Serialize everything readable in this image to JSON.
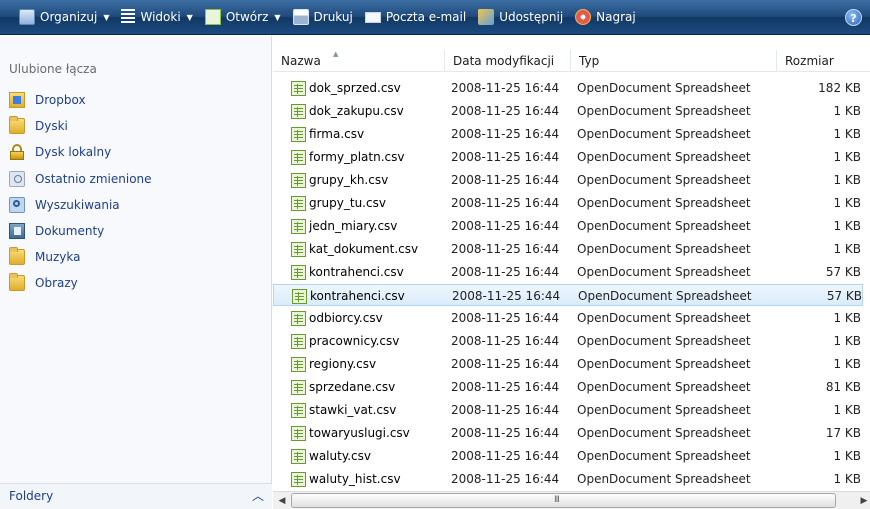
{
  "toolbar": {
    "organize": "Organizuj",
    "views": "Widoki",
    "open": "Otwórz",
    "print": "Drukuj",
    "email": "Poczta e-mail",
    "share": "Udostępnij",
    "burn": "Nagraj",
    "help": "?"
  },
  "sidebar": {
    "heading": "Ulubione łącza",
    "items": [
      {
        "label": "Dropbox",
        "icon": "dropbox-folder-icon"
      },
      {
        "label": "Dyski",
        "icon": "folder-icon"
      },
      {
        "label": "Dysk lokalny",
        "icon": "lock-icon"
      },
      {
        "label": "Ostatnio zmienione",
        "icon": "recent-icon"
      },
      {
        "label": "Wyszukiwania",
        "icon": "search-folder-icon"
      },
      {
        "label": "Dokumenty",
        "icon": "documents-icon"
      },
      {
        "label": "Muzyka",
        "icon": "folder-icon"
      },
      {
        "label": "Obrazy",
        "icon": "folder-icon"
      }
    ],
    "folders_label": "Foldery"
  },
  "columns": {
    "name": "Nazwa",
    "date": "Data modyfikacji",
    "type": "Typ",
    "size": "Rozmiar"
  },
  "files": [
    {
      "name": "dok_sprzed.csv",
      "date": "2008-11-25 16:44",
      "type": "OpenDocument Spreadsheet",
      "size": "182 KB"
    },
    {
      "name": "dok_zakupu.csv",
      "date": "2008-11-25 16:44",
      "type": "OpenDocument Spreadsheet",
      "size": "1 KB"
    },
    {
      "name": "firma.csv",
      "date": "2008-11-25 16:44",
      "type": "OpenDocument Spreadsheet",
      "size": "1 KB"
    },
    {
      "name": "formy_platn.csv",
      "date": "2008-11-25 16:44",
      "type": "OpenDocument Spreadsheet",
      "size": "1 KB"
    },
    {
      "name": "grupy_kh.csv",
      "date": "2008-11-25 16:44",
      "type": "OpenDocument Spreadsheet",
      "size": "1 KB"
    },
    {
      "name": "grupy_tu.csv",
      "date": "2008-11-25 16:44",
      "type": "OpenDocument Spreadsheet",
      "size": "1 KB"
    },
    {
      "name": "jedn_miary.csv",
      "date": "2008-11-25 16:44",
      "type": "OpenDocument Spreadsheet",
      "size": "1 KB"
    },
    {
      "name": "kat_dokument.csv",
      "date": "2008-11-25 16:44",
      "type": "OpenDocument Spreadsheet",
      "size": "1 KB"
    },
    {
      "name": "kontrahenci.csv",
      "date": "2008-11-25 16:44",
      "type": "OpenDocument Spreadsheet",
      "size": "57 KB"
    },
    {
      "name": "kontrahenci.csv",
      "date": "2008-11-25 16:44",
      "type": "OpenDocument Spreadsheet",
      "size": "57 KB",
      "selected": true
    },
    {
      "name": "odbiorcy.csv",
      "date": "2008-11-25 16:44",
      "type": "OpenDocument Spreadsheet",
      "size": "1 KB"
    },
    {
      "name": "pracownicy.csv",
      "date": "2008-11-25 16:44",
      "type": "OpenDocument Spreadsheet",
      "size": "1 KB"
    },
    {
      "name": "regiony.csv",
      "date": "2008-11-25 16:44",
      "type": "OpenDocument Spreadsheet",
      "size": "1 KB"
    },
    {
      "name": "sprzedane.csv",
      "date": "2008-11-25 16:44",
      "type": "OpenDocument Spreadsheet",
      "size": "81 KB"
    },
    {
      "name": "stawki_vat.csv",
      "date": "2008-11-25 16:44",
      "type": "OpenDocument Spreadsheet",
      "size": "1 KB"
    },
    {
      "name": "towaryuslugi.csv",
      "date": "2008-11-25 16:44",
      "type": "OpenDocument Spreadsheet",
      "size": "17 KB"
    },
    {
      "name": "waluty.csv",
      "date": "2008-11-25 16:44",
      "type": "OpenDocument Spreadsheet",
      "size": "1 KB"
    },
    {
      "name": "waluty_hist.csv",
      "date": "2008-11-25 16:44",
      "type": "OpenDocument Spreadsheet",
      "size": "1 KB"
    }
  ],
  "scrollbar": {
    "grip": "III"
  }
}
